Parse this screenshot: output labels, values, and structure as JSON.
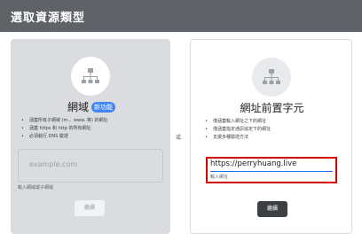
{
  "dialog": {
    "title": "選取資源類型"
  },
  "separator": "或",
  "domain_card": {
    "icon": "sitemap-icon",
    "title": "網域",
    "badge": "新功能",
    "bullets": [
      "涵蓋所有子網域 (m.、www. 等) 的網址",
      "涵蓋 https 和 http 的所有網址",
      "必須執行 DNS 驗證"
    ],
    "input_placeholder": "example.com",
    "input_hint": "輸入網域或子網域",
    "continue_label": "繼續"
  },
  "prefix_card": {
    "icon": "sitemap-icon",
    "title": "網址前置字元",
    "bullets": [
      "僅涵蓋輸入網址之下的網址",
      "僅涵蓋指定通訊協定下的網址",
      "支援多種驗證方法"
    ],
    "input_value": "https://perryhuang.live",
    "input_hint": "輸入網址",
    "continue_label": "繼續"
  },
  "colors": {
    "title_bar": "#5f6368",
    "highlight": "#d50000",
    "badge": "#4285f4",
    "primary_button": "#3c4043"
  }
}
